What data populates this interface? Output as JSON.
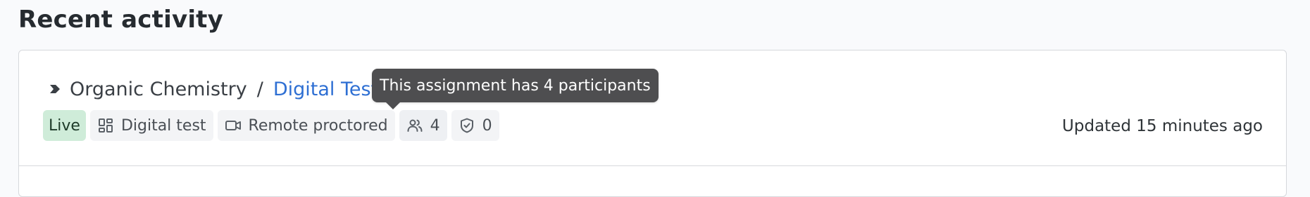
{
  "section": {
    "title": "Recent activity"
  },
  "activity_item": {
    "course": "Organic Chemistry",
    "separator": "/",
    "assignment": "Digital Test",
    "tags": {
      "status": "Live",
      "type": "Digital test",
      "proctoring": "Remote proctored",
      "participants": "4",
      "submissions": "0"
    },
    "updated": "Updated 15 minutes ago"
  },
  "tooltip": {
    "text": "This assignment has 4 participants"
  },
  "icons": {
    "breadcrumb": "chevron-tag-icon",
    "type": "dashboard-grid-icon",
    "proctoring": "video-camera-icon",
    "participants": "people-icon",
    "submissions": "shield-check-icon"
  },
  "colors": {
    "link": "#2e6fd3",
    "live_bg": "#cfecd9",
    "hidden_badge_outline": "#f3c23a",
    "tooltip_bg": "#4e4e50"
  }
}
